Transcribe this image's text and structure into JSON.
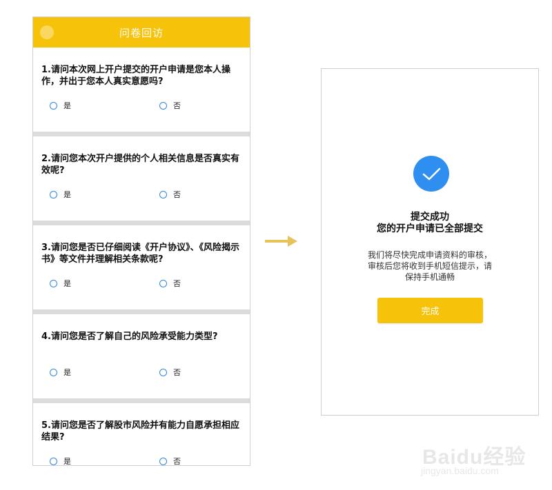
{
  "survey": {
    "header_title": "问卷回访",
    "questions": [
      {
        "text": "1.请问本次网上开户提交的开户申请是您本人操作，并出于您本人真实意愿吗?",
        "yes": "是",
        "no": "否"
      },
      {
        "text": "2.请问您本次开户提供的个人相关信息是否真实有效呢?",
        "yes": "是",
        "no": "否"
      },
      {
        "text": "3.请问您是否已仔细阅读《开户协议》、《风险揭示书》等文件并理解相关条款呢?",
        "yes": "是",
        "no": "否"
      },
      {
        "text": "4.请问您是否了解自己的风险承受能力类型?",
        "yes": "是",
        "no": "否"
      },
      {
        "text": "5.请问您是否了解股市风险并有能力自愿承担相应结果?",
        "yes": "是",
        "no": "否"
      }
    ]
  },
  "success": {
    "title_line1": "提交成功",
    "title_line2": "您的开户申请已全部提交",
    "description": "我们将尽快完成申请资料的审核，审核后您将收到手机短信提示，请保持手机通畅",
    "done_label": "完成"
  },
  "watermark": {
    "main": "Baidu经验",
    "sub": "jingyan.baidu.com"
  },
  "colors": {
    "accent_yellow": "#f7c20a",
    "check_blue": "#2e8ff0",
    "arrow": "#e8c25a"
  }
}
